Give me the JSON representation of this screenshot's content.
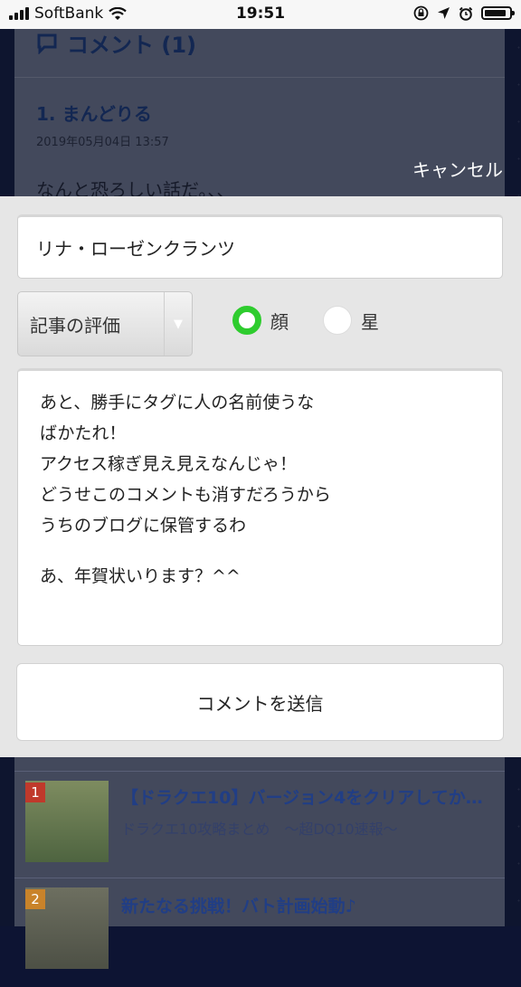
{
  "status_bar": {
    "carrier": "SoftBank",
    "time": "19:51",
    "battery_level": 0.9
  },
  "background": {
    "comments_header": "コメント (1)",
    "comment_author": "1. まんどりる",
    "comment_date": "2019年05月04日 13:57",
    "comment_excerpt": "なんと恐ろしい話だ。、、"
  },
  "modal": {
    "cancel_label": "キャンセル",
    "name_value": "リナ・ローゼンクランツ",
    "rating_select_value": "記事の評価",
    "rating_options": [
      {
        "label": "顔",
        "selected": true
      },
      {
        "label": "星",
        "selected": false
      }
    ],
    "comment_lines": [
      "あと、勝手にタグに人の名前使うな",
      "ばかたれ！",
      "アクセス稼ぎ見え見えなんじゃ！",
      "どうせこのコメントも消すだろうから",
      "うちのブログに保管するわ"
    ],
    "comment_tail": "あ、年賀状いります？^^",
    "submit_label": "コメントを送信"
  },
  "related": [
    {
      "rank": "1",
      "title": "【ドラクエ10】バージョン4をクリアしてか…",
      "sub": "ドラクエ10攻略まとめ　～超DQ10速報～",
      "rank_color": "#c0392b"
    },
    {
      "rank": "2",
      "title": "新たなる挑戦！バト計画始動♪",
      "sub": "",
      "rank_color": "#c9832a"
    }
  ]
}
